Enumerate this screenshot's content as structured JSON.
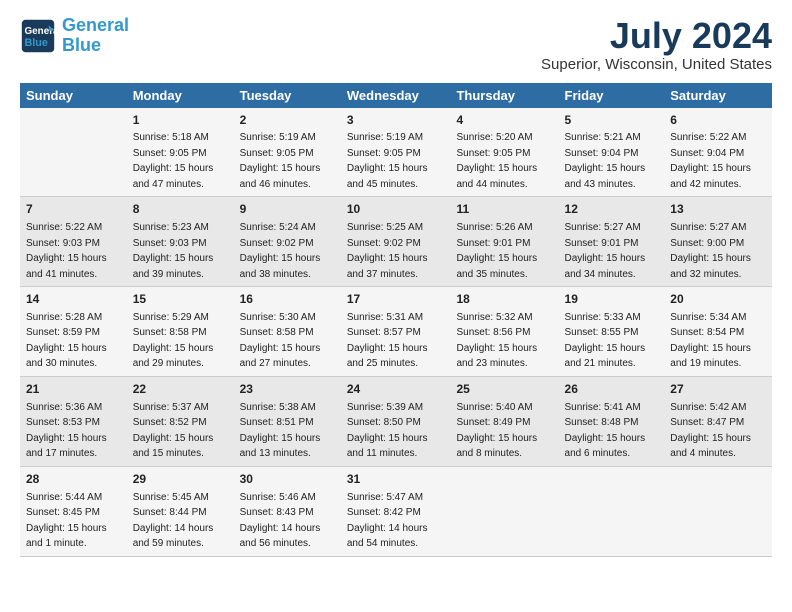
{
  "logo": {
    "line1": "General",
    "line2": "Blue"
  },
  "title": "July 2024",
  "subtitle": "Superior, Wisconsin, United States",
  "header": {
    "days": [
      "Sunday",
      "Monday",
      "Tuesday",
      "Wednesday",
      "Thursday",
      "Friday",
      "Saturday"
    ]
  },
  "rows": [
    [
      {
        "num": "",
        "text": ""
      },
      {
        "num": "1",
        "text": "Sunrise: 5:18 AM\nSunset: 9:05 PM\nDaylight: 15 hours\nand 47 minutes."
      },
      {
        "num": "2",
        "text": "Sunrise: 5:19 AM\nSunset: 9:05 PM\nDaylight: 15 hours\nand 46 minutes."
      },
      {
        "num": "3",
        "text": "Sunrise: 5:19 AM\nSunset: 9:05 PM\nDaylight: 15 hours\nand 45 minutes."
      },
      {
        "num": "4",
        "text": "Sunrise: 5:20 AM\nSunset: 9:05 PM\nDaylight: 15 hours\nand 44 minutes."
      },
      {
        "num": "5",
        "text": "Sunrise: 5:21 AM\nSunset: 9:04 PM\nDaylight: 15 hours\nand 43 minutes."
      },
      {
        "num": "6",
        "text": "Sunrise: 5:22 AM\nSunset: 9:04 PM\nDaylight: 15 hours\nand 42 minutes."
      }
    ],
    [
      {
        "num": "7",
        "text": "Sunrise: 5:22 AM\nSunset: 9:03 PM\nDaylight: 15 hours\nand 41 minutes."
      },
      {
        "num": "8",
        "text": "Sunrise: 5:23 AM\nSunset: 9:03 PM\nDaylight: 15 hours\nand 39 minutes."
      },
      {
        "num": "9",
        "text": "Sunrise: 5:24 AM\nSunset: 9:02 PM\nDaylight: 15 hours\nand 38 minutes."
      },
      {
        "num": "10",
        "text": "Sunrise: 5:25 AM\nSunset: 9:02 PM\nDaylight: 15 hours\nand 37 minutes."
      },
      {
        "num": "11",
        "text": "Sunrise: 5:26 AM\nSunset: 9:01 PM\nDaylight: 15 hours\nand 35 minutes."
      },
      {
        "num": "12",
        "text": "Sunrise: 5:27 AM\nSunset: 9:01 PM\nDaylight: 15 hours\nand 34 minutes."
      },
      {
        "num": "13",
        "text": "Sunrise: 5:27 AM\nSunset: 9:00 PM\nDaylight: 15 hours\nand 32 minutes."
      }
    ],
    [
      {
        "num": "14",
        "text": "Sunrise: 5:28 AM\nSunset: 8:59 PM\nDaylight: 15 hours\nand 30 minutes."
      },
      {
        "num": "15",
        "text": "Sunrise: 5:29 AM\nSunset: 8:58 PM\nDaylight: 15 hours\nand 29 minutes."
      },
      {
        "num": "16",
        "text": "Sunrise: 5:30 AM\nSunset: 8:58 PM\nDaylight: 15 hours\nand 27 minutes."
      },
      {
        "num": "17",
        "text": "Sunrise: 5:31 AM\nSunset: 8:57 PM\nDaylight: 15 hours\nand 25 minutes."
      },
      {
        "num": "18",
        "text": "Sunrise: 5:32 AM\nSunset: 8:56 PM\nDaylight: 15 hours\nand 23 minutes."
      },
      {
        "num": "19",
        "text": "Sunrise: 5:33 AM\nSunset: 8:55 PM\nDaylight: 15 hours\nand 21 minutes."
      },
      {
        "num": "20",
        "text": "Sunrise: 5:34 AM\nSunset: 8:54 PM\nDaylight: 15 hours\nand 19 minutes."
      }
    ],
    [
      {
        "num": "21",
        "text": "Sunrise: 5:36 AM\nSunset: 8:53 PM\nDaylight: 15 hours\nand 17 minutes."
      },
      {
        "num": "22",
        "text": "Sunrise: 5:37 AM\nSunset: 8:52 PM\nDaylight: 15 hours\nand 15 minutes."
      },
      {
        "num": "23",
        "text": "Sunrise: 5:38 AM\nSunset: 8:51 PM\nDaylight: 15 hours\nand 13 minutes."
      },
      {
        "num": "24",
        "text": "Sunrise: 5:39 AM\nSunset: 8:50 PM\nDaylight: 15 hours\nand 11 minutes."
      },
      {
        "num": "25",
        "text": "Sunrise: 5:40 AM\nSunset: 8:49 PM\nDaylight: 15 hours\nand 8 minutes."
      },
      {
        "num": "26",
        "text": "Sunrise: 5:41 AM\nSunset: 8:48 PM\nDaylight: 15 hours\nand 6 minutes."
      },
      {
        "num": "27",
        "text": "Sunrise: 5:42 AM\nSunset: 8:47 PM\nDaylight: 15 hours\nand 4 minutes."
      }
    ],
    [
      {
        "num": "28",
        "text": "Sunrise: 5:44 AM\nSunset: 8:45 PM\nDaylight: 15 hours\nand 1 minute."
      },
      {
        "num": "29",
        "text": "Sunrise: 5:45 AM\nSunset: 8:44 PM\nDaylight: 14 hours\nand 59 minutes."
      },
      {
        "num": "30",
        "text": "Sunrise: 5:46 AM\nSunset: 8:43 PM\nDaylight: 14 hours\nand 56 minutes."
      },
      {
        "num": "31",
        "text": "Sunrise: 5:47 AM\nSunset: 8:42 PM\nDaylight: 14 hours\nand 54 minutes."
      },
      {
        "num": "",
        "text": ""
      },
      {
        "num": "",
        "text": ""
      },
      {
        "num": "",
        "text": ""
      }
    ]
  ]
}
